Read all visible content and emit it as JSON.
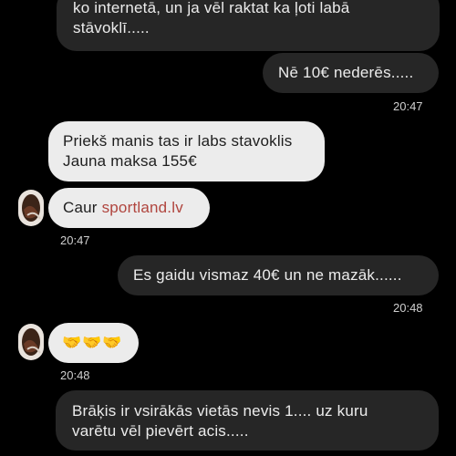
{
  "messages": {
    "m1": {
      "line1": "ko internetā, un ja vēl raktat ka ļoti labā",
      "line2": "stāvoklī....."
    },
    "m2": {
      "text": "Nē 10€ nederēs.....",
      "time": "20:47"
    },
    "m3": {
      "line1": "Priekš manis tas ir labs stavoklis",
      "line2": "Jauna maksa 155€"
    },
    "m4": {
      "prefix": "Caur ",
      "link": "sportland.lv",
      "time": "20:47"
    },
    "m5": {
      "text": "Es gaidu vismaz 40€ un ne mazāk......",
      "time": "20:48"
    },
    "m6": {
      "emoji": "🤝🤝🤝",
      "time": "20:48"
    },
    "m7": {
      "line1": "Brāķis ir vsirākās vietās nevis 1.... uz kuru",
      "line2": "varētu vēl pievērt acis....."
    }
  },
  "colors": {
    "background": "#000000",
    "outgoing_bubble": "#262626",
    "incoming_bubble": "#ececec",
    "link": "#b0453e"
  }
}
